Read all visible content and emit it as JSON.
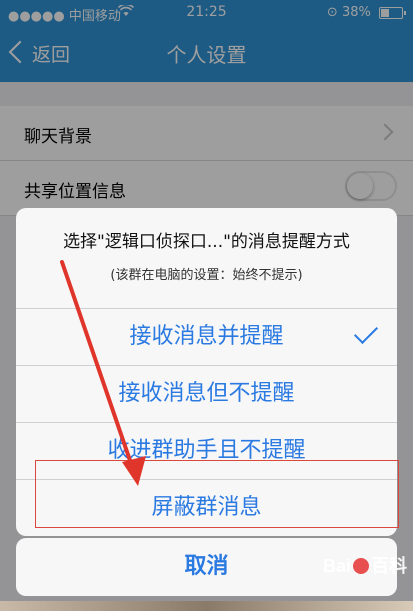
{
  "status_bar": {
    "carrier": "●●●●● 中国移动",
    "time": "21:25",
    "battery": "38%",
    "battery_level": 0.38
  },
  "nav": {
    "back_label": "返回",
    "title": "个人设置"
  },
  "settings": {
    "rows": [
      {
        "label": "聊天背景",
        "type": "chevron"
      },
      {
        "label": "共享位置信息",
        "type": "toggle",
        "on": false
      }
    ]
  },
  "sheet": {
    "title": "选择\"逻辑口侦探口...\"的消息提醒方式",
    "subtitle": "(该群在电脑的设置：始终不提示)",
    "options": [
      {
        "label": "接收消息并提醒",
        "selected": true
      },
      {
        "label": "接收消息但不提醒",
        "selected": false
      },
      {
        "label": "收进群助手且不提醒",
        "selected": false
      },
      {
        "label": "屏蔽群消息",
        "selected": false
      }
    ],
    "cancel_label": "取消"
  },
  "watermark": {
    "text_left": "Bai",
    "text_right": "百科"
  },
  "colors": {
    "nav_blue": "#2f93d6",
    "ios_blue": "#2a7ae2",
    "highlight_red": "#d9473d"
  }
}
